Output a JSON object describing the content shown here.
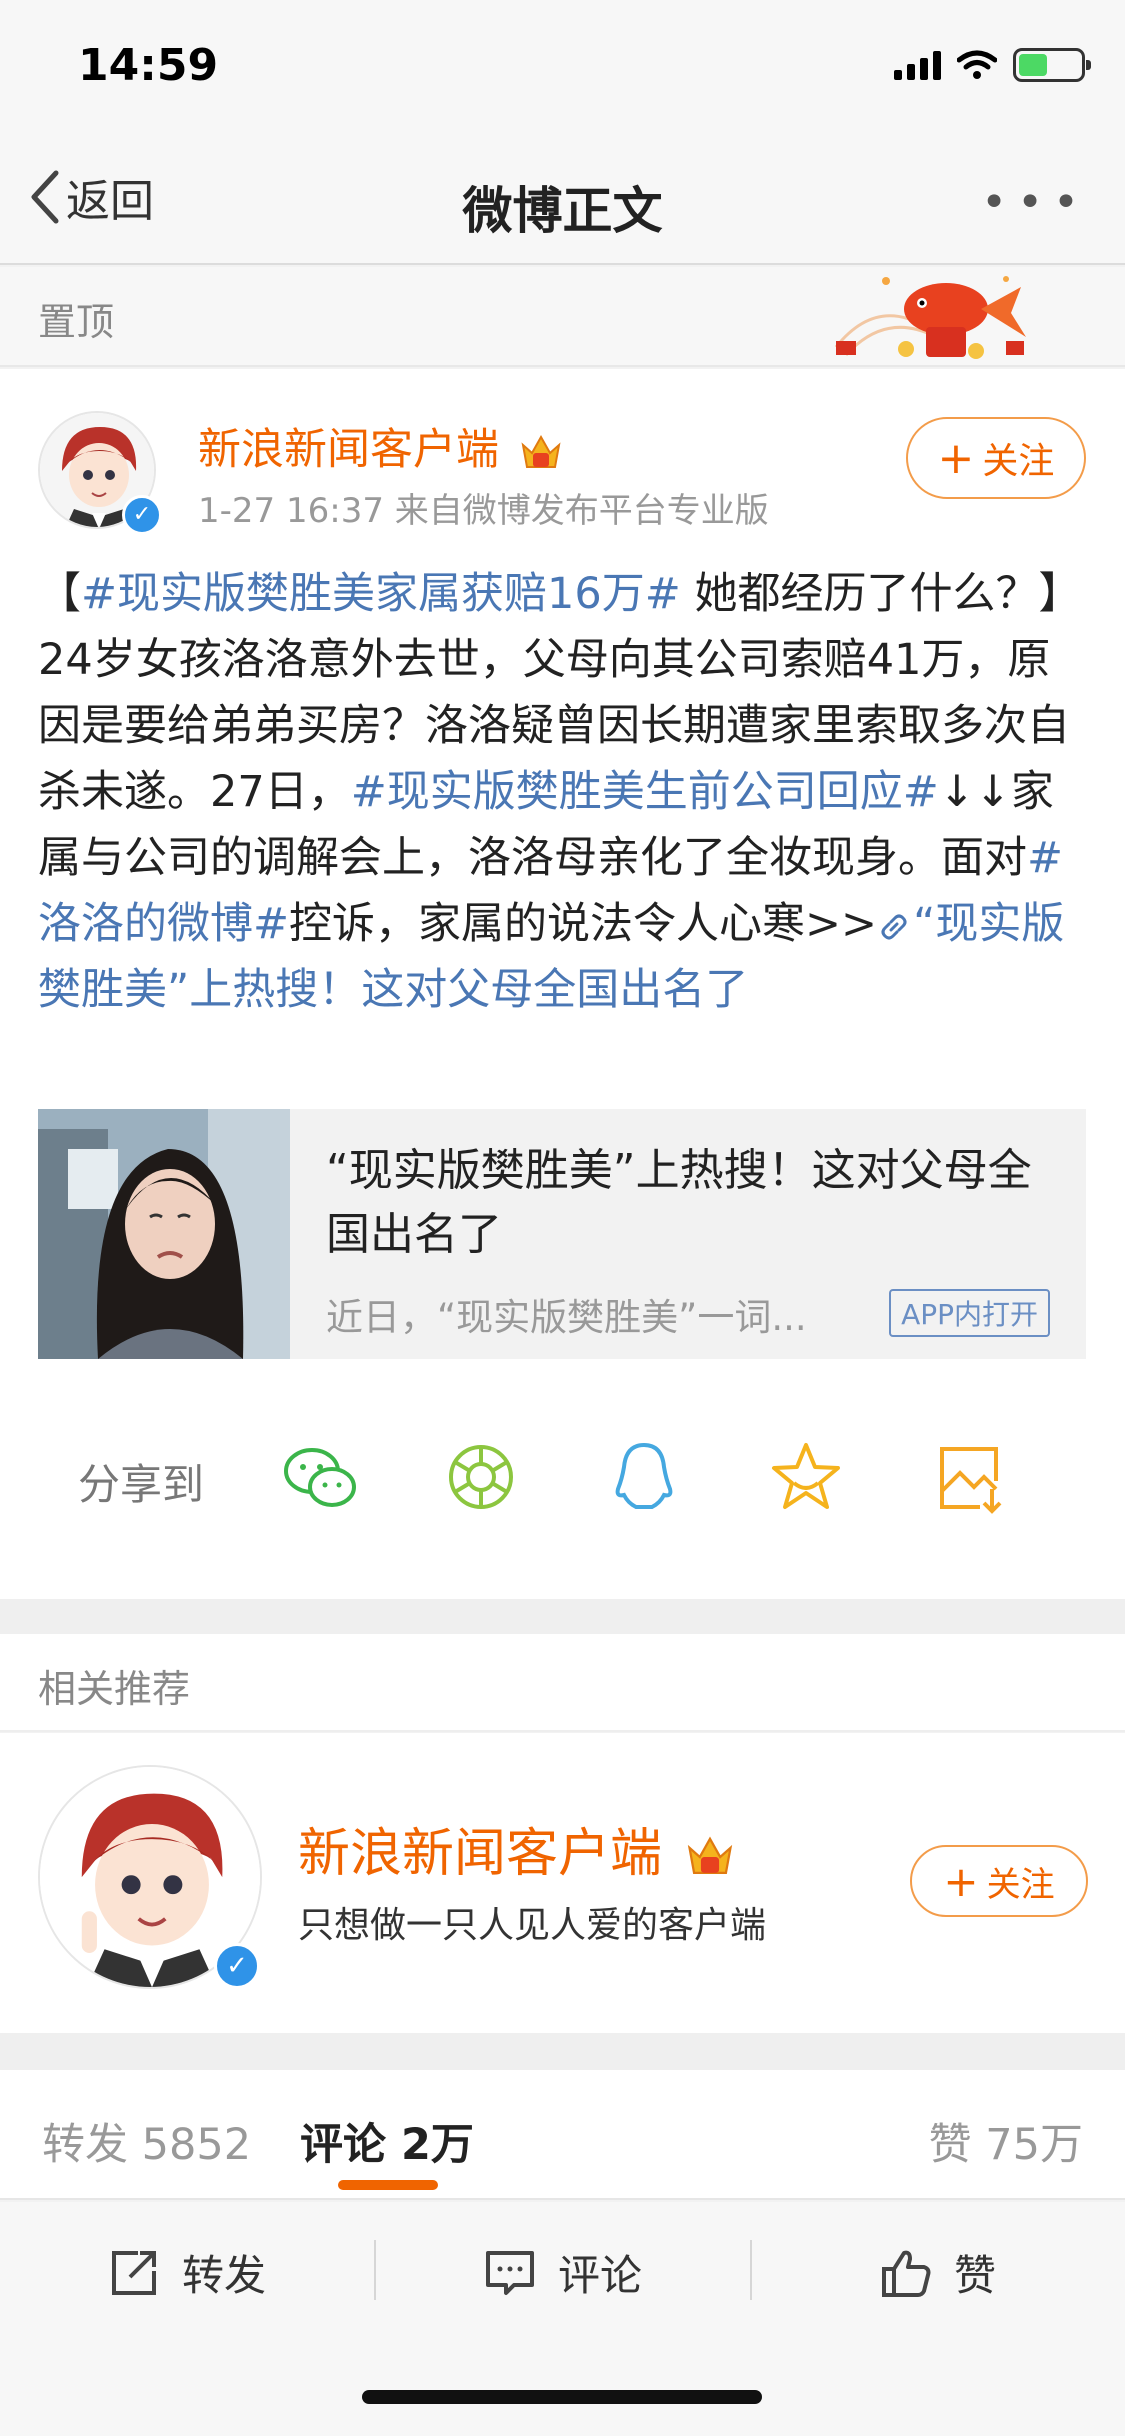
{
  "status_bar": {
    "time": "14:59"
  },
  "nav": {
    "back_label": "返回",
    "title": "微博正文"
  },
  "pinned": {
    "label": "置顶"
  },
  "post": {
    "author": "新浪新闻客户端",
    "meta": "1-27 16:37  来自微博发布平台专业版",
    "follow_label": "关注",
    "text": {
      "p1": "【",
      "tag1": "#现实版樊胜美家属获赔16万#",
      "p2": " 她都经历了什么？】24岁女孩洛洛意外去世，父母向其公司索赔41万，原因是要给弟弟买房？洛洛疑曾因长期遭家里索取多次自杀未遂。27日，",
      "tag2": "#现实版樊胜美生前公司回应#",
      "p3": "↓↓家属与公司的调解会上，洛洛母亲化了全妆现身。面对",
      "tag3": "#洛洛的微博#",
      "p4": "控诉，家属的说法令人心寒>>",
      "link": "“现实版樊胜美”上热搜！这对父母全国出名了"
    },
    "card": {
      "title": "“现实版樊胜美”上热搜！这对父母全国出名了",
      "desc": "近日，“现实版樊胜美”一词...",
      "badge": "APP内打开"
    },
    "share_label": "分享到",
    "share_icons": [
      "wechat-icon",
      "moments-icon",
      "qq-icon",
      "favorite-star-icon",
      "save-image-icon"
    ]
  },
  "related": {
    "title": "相关推荐",
    "name": "新浪新闻客户端",
    "desc": "只想做一只人见人爱的客户端",
    "follow_label": "关注"
  },
  "stats": {
    "repost": "转发 5852",
    "comment": "评论 2万",
    "like": "赞 75万"
  },
  "actions": {
    "repost": "转发",
    "comment": "评论",
    "like": "赞"
  },
  "colors": {
    "accent": "#f06400",
    "link": "#4a77b4",
    "verified": "#2f93e8"
  }
}
